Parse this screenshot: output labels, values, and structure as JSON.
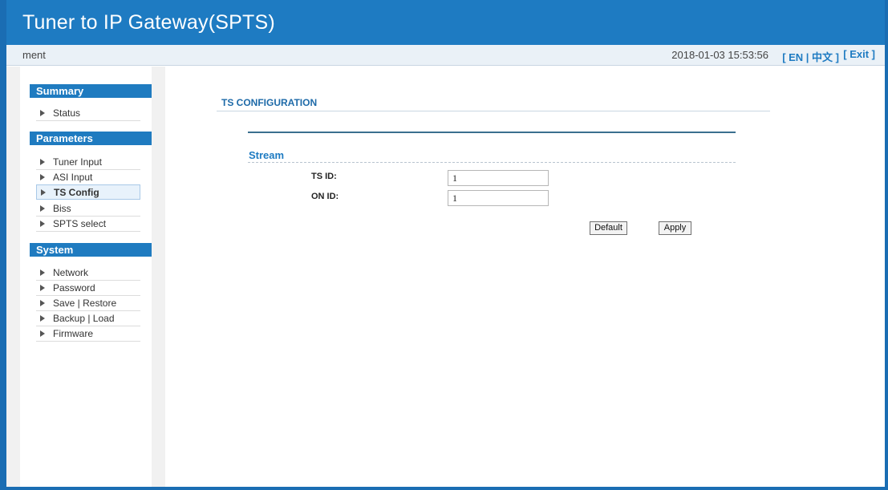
{
  "header": {
    "title": "Tuner to IP Gateway(SPTS)"
  },
  "infobar": {
    "marquee": "ment",
    "datetime": "2018-01-03 15:53:56",
    "lang": "[ EN | 中文 ]",
    "exit": "[ Exit ]"
  },
  "sidebar": {
    "sections": [
      {
        "title": "Summary",
        "items": [
          "Status"
        ]
      },
      {
        "title": "Parameters",
        "items": [
          "Tuner Input",
          "ASI Input",
          "TS Config",
          "Biss",
          "SPTS select"
        ]
      },
      {
        "title": "System",
        "items": [
          "Network",
          "Password",
          "Save | Restore",
          "Backup | Load",
          "Firmware"
        ]
      }
    ],
    "active_item": "TS Config"
  },
  "main": {
    "page_title": "TS CONFIGURATION",
    "panel_title": "Stream",
    "fields": [
      {
        "label": "TS ID:",
        "value": "1"
      },
      {
        "label": "ON ID:",
        "value": "1"
      }
    ],
    "buttons": {
      "default": "Default",
      "apply": "Apply"
    }
  },
  "colors": {
    "header_bg": "#1e7bc2",
    "section_head_bg": "#1f7bc0",
    "accent_text": "#1e7bc2"
  }
}
